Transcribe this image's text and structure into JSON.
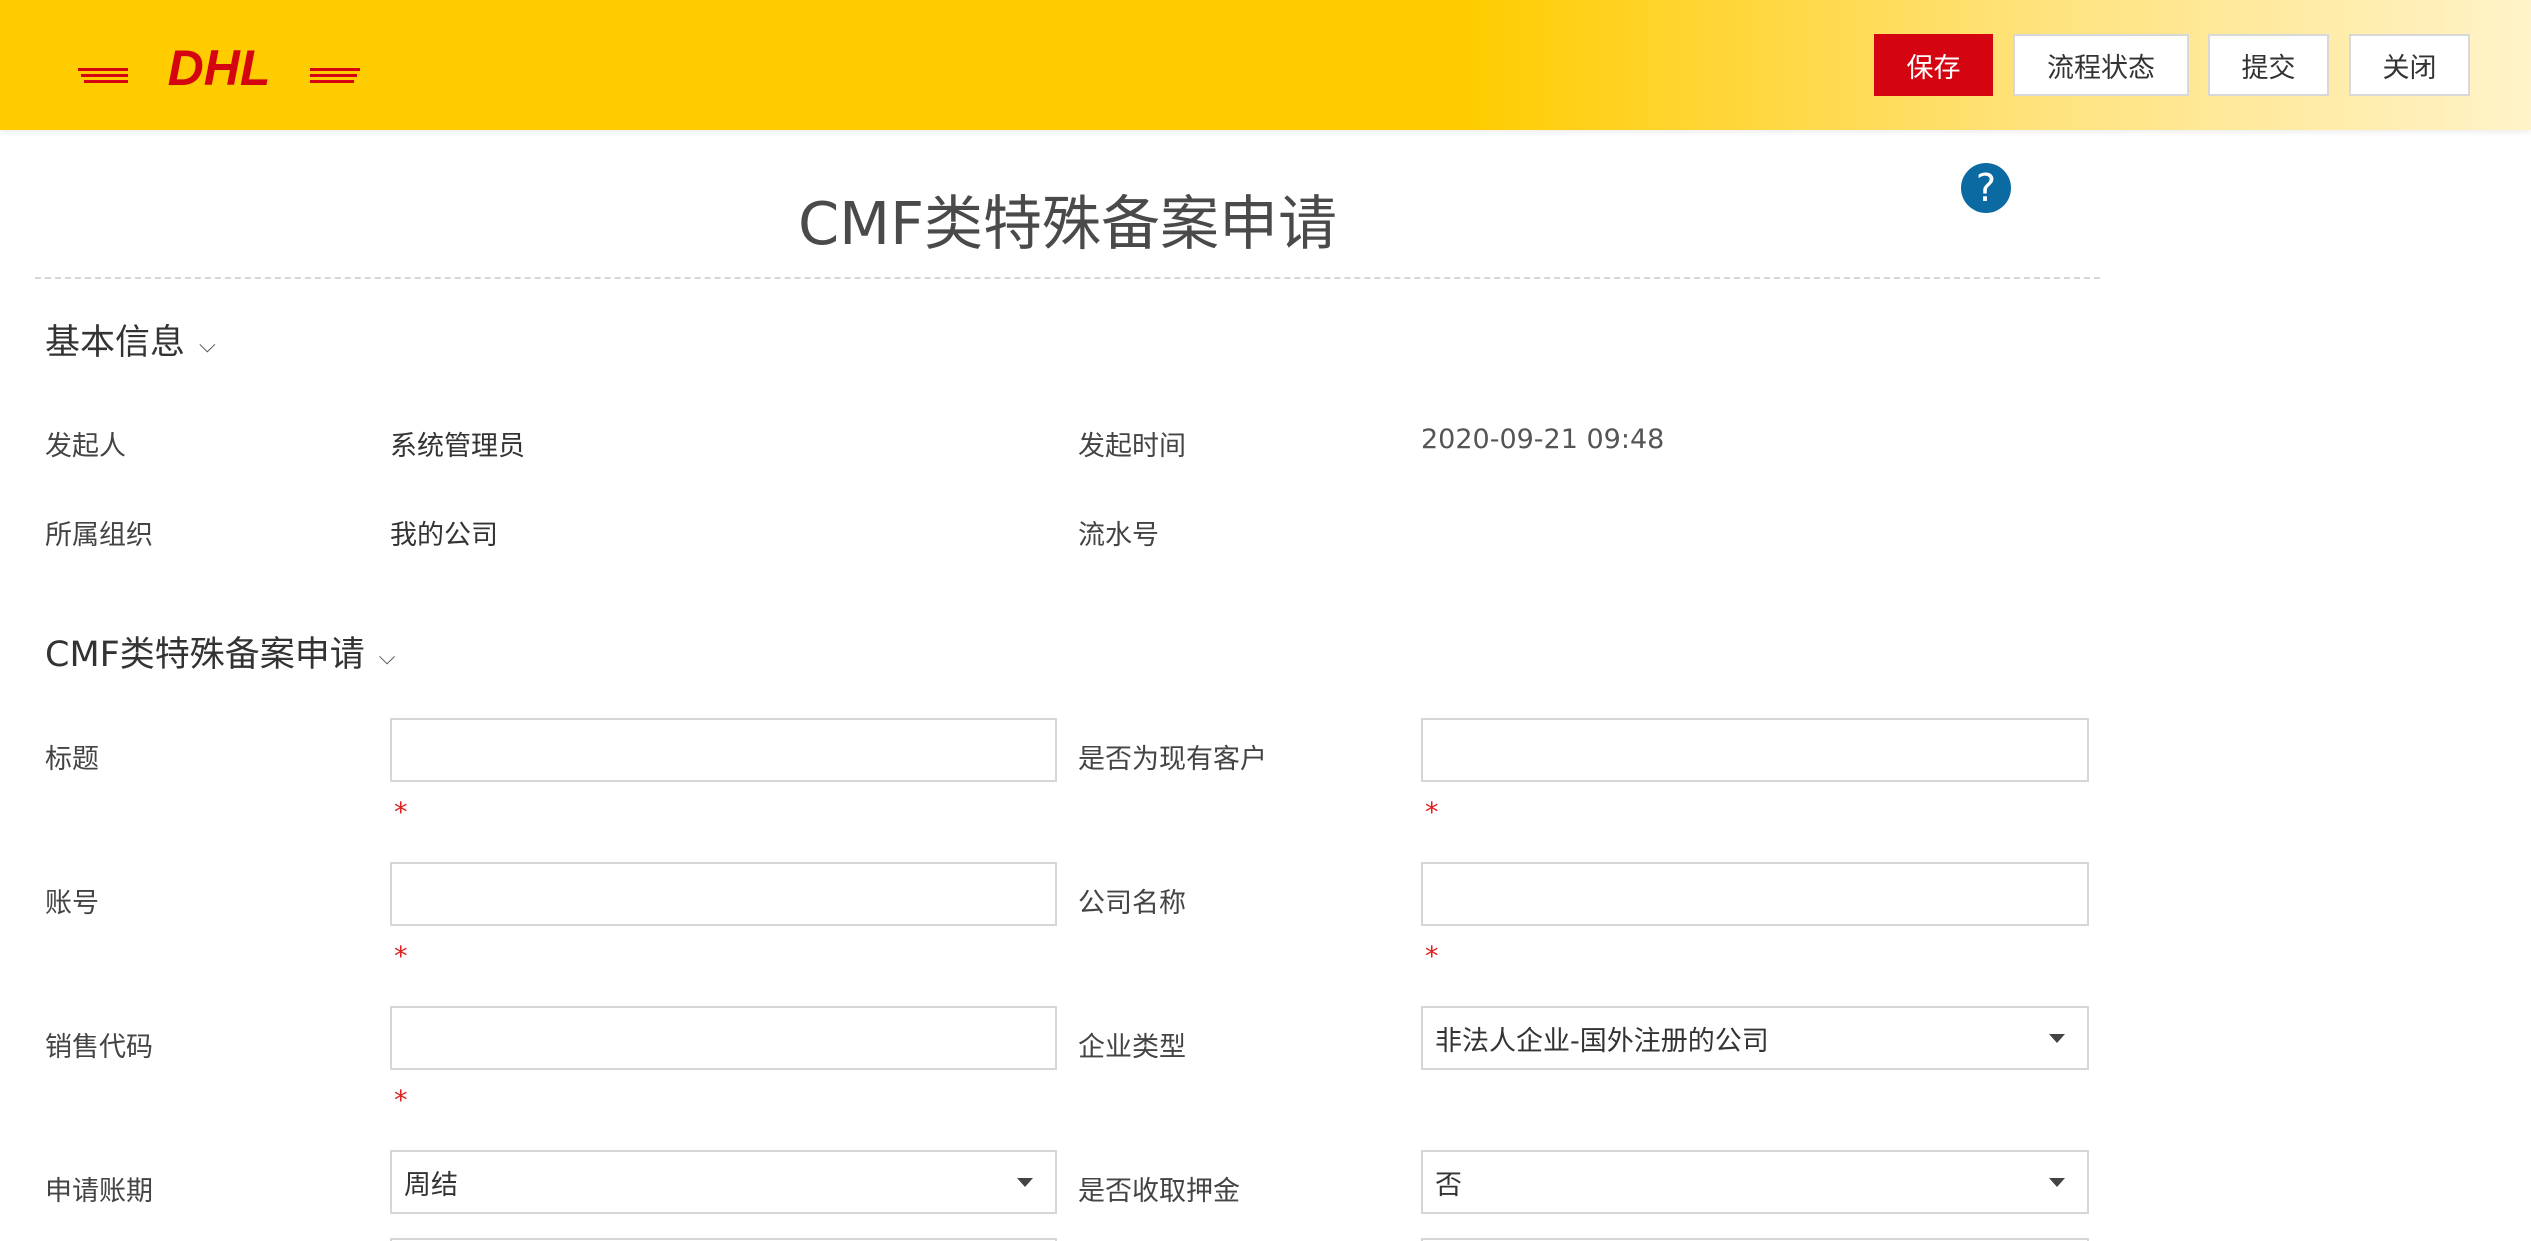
{
  "header": {
    "brand": "DHL",
    "buttons": {
      "save": "保存",
      "status": "流程状态",
      "submit": "提交",
      "close": "关闭"
    },
    "brand_color": "#ffcc00",
    "accent_color": "#d40511"
  },
  "page": {
    "title": "CMF类特殊备案申请",
    "help_icon": "?"
  },
  "basic_info": {
    "title": "基本信息",
    "chevron": "⌵",
    "initiator_label": "发起人",
    "initiator_value": "系统管理员",
    "time_label": "发起时间",
    "time_value": "2020-09-21 09:48",
    "org_label": "所属组织",
    "org_value": "我的公司",
    "serial_label": "流水号",
    "serial_value": ""
  },
  "form": {
    "title": "CMF类特殊备案申请",
    "chevron": "⌵",
    "required_mark": "*",
    "title_label": "标题",
    "title_value": "",
    "existing_customer_label": "是否为现有客户",
    "existing_customer_value": "",
    "account_label": "账号",
    "account_value": "",
    "company_label": "公司名称",
    "company_value": "",
    "sales_code_label": "销售代码",
    "sales_code_value": "",
    "enterprise_type_label": "企业类型",
    "enterprise_type_value": "非法人企业-国外注册的公司",
    "billing_period_label": "申请账期",
    "billing_period_value": "周结",
    "deposit_label": "是否收取押金",
    "deposit_value": "否"
  }
}
